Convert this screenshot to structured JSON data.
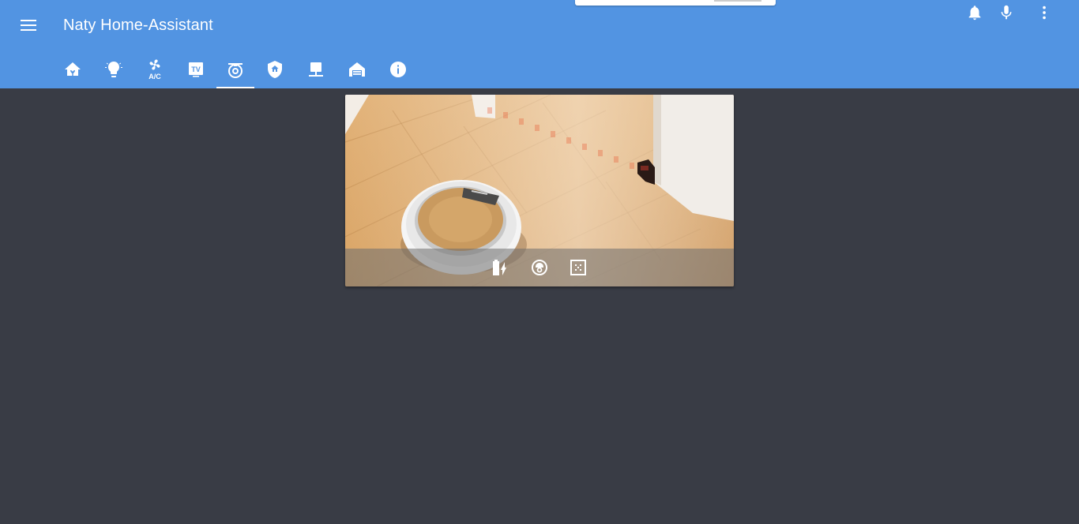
{
  "app": {
    "title": "Naty Home-Assistant",
    "accent_color": "#5294e2",
    "background_color": "#393c45"
  },
  "header": {
    "menu_icon": "menu-icon",
    "actions": [
      {
        "name": "notifications",
        "icon": "bell-icon"
      },
      {
        "name": "voice",
        "icon": "microphone-icon"
      },
      {
        "name": "more",
        "icon": "more-vert-icon"
      }
    ]
  },
  "tabs": [
    {
      "name": "home",
      "icon": "home-plant-icon"
    },
    {
      "name": "lights",
      "icon": "lightbulb-icon"
    },
    {
      "name": "ac",
      "icon": "fan-ac-icon",
      "text": "A/C"
    },
    {
      "name": "tv",
      "icon": "tv-icon",
      "text": "TV"
    },
    {
      "name": "vacuum",
      "icon": "robot-vacuum-icon",
      "active": true
    },
    {
      "name": "security",
      "icon": "shield-home-icon"
    },
    {
      "name": "desk",
      "icon": "desk-lamp-icon"
    },
    {
      "name": "garage",
      "icon": "garage-icon"
    },
    {
      "name": "info",
      "icon": "information-icon"
    }
  ],
  "vacuum_card": {
    "image": "robot-vacuum-on-wooden-floor",
    "buttons": [
      {
        "name": "return-to-dock",
        "icon": "battery-charging-icon"
      },
      {
        "name": "start-cleaning",
        "icon": "robot-vacuum-icon"
      },
      {
        "name": "spot-clean",
        "icon": "select-area-icon"
      }
    ]
  }
}
